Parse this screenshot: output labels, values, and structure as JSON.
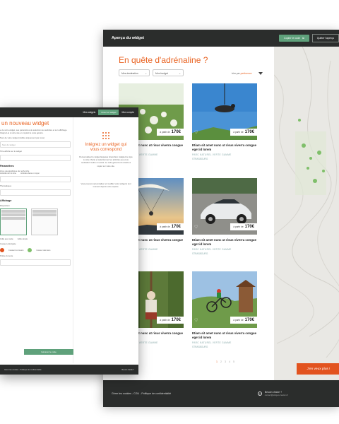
{
  "preview": {
    "title": "Aperçu du widget",
    "copy_label": "Copier le code",
    "quit_label": "Quitter l'aperçu",
    "headline": "En quête d'adrénaline ?",
    "filter_destination": "Mes destination",
    "filter_budget": "Mon budget",
    "sort_prefix": "trier par",
    "sort_value": "pertinence",
    "cards": [
      {
        "title": "Etiam sit amet nunc ut risus viverra congue eget id lorem",
        "meta": "PARC NATUREL VERTE GAMME",
        "meta2": "STRASBOURG",
        "price_prefix": "à partir de",
        "price": "170€"
      },
      {
        "title": "Etiam sit amet nunc ut risus viverra congue eget id lorem",
        "meta": "PARC NATUREL VERTE GAMME",
        "meta2": "STRASBOURG",
        "price_prefix": "à partir de",
        "price": "170€"
      },
      {
        "title": "Etiam sit amet nunc ut risus viverra congue eget id lorem",
        "meta": "PARC NATUREL VERTE GAMME",
        "meta2": "STRASBOURG",
        "price_prefix": "à partir de",
        "price": "170€"
      },
      {
        "title": "Etiam sit amet nunc ut risus viverra congue eget id lorem",
        "meta": "PARC NATUREL VERTE GAMME",
        "meta2": "STRASBOURG",
        "price_prefix": "à partir de",
        "price": "170€"
      },
      {
        "title": "Etiam sit amet nunc ut risus viverra congue eget id lorem",
        "meta": "PARC NATUREL VERTE GAMME",
        "meta2": "STRASBOURG",
        "price_prefix": "à partir de",
        "price": "170€"
      },
      {
        "title": "Etiam sit amet nunc ut risus viverra congue eget id lorem",
        "meta": "PARC NATUREL VERTE GAMME",
        "meta2": "STRASBOURG",
        "price_prefix": "à partir de",
        "price": "170€"
      }
    ],
    "pages": [
      "1",
      "2",
      "3",
      "4",
      "5"
    ],
    "cta": "J'en veux plus !",
    "footer_links": "Gérer les cookies - CGU - Politique de confidentialité",
    "help_title": "Besoin d'aide ?",
    "help_email": "contact@widget-creation.fr"
  },
  "form": {
    "nav_widgets": "Mes widgets",
    "nav_new": "Créer un widget",
    "nav_account": "Mon compte",
    "title": "un nouveau widget",
    "intro": "e de votre widget, ses paramètres de sélection des activités et son affichage. Intégrez-le à votre site en copiant le code généré.",
    "label_name": "Nom de votre widget (visible uniquement par vous)",
    "placeholder_name": "Nom du widget",
    "label_headline": "Titre affiché sur le widget",
    "section_params": "Paramètres",
    "label_zone": "Zone géographique de recherche",
    "opt_a": "Activités sur la zone",
    "opt_b": "Activités dans un rayon",
    "label_theme": "Thématiques",
    "section_display": "Affichage",
    "label_layout": "Disposition",
    "layout_a": "Grille avec carte",
    "layout_b": "Grille simple",
    "label_color": "Couleur principale",
    "color_a": "Couleur du bouton",
    "color_b": "Couleur des liens",
    "label_font": "Police du texte",
    "submit": "Générer le code",
    "side_title": "Intégrez un widget qui vous correspond",
    "side_text": "Personnalisez le widget Espaces Grand Est. Adaptez le style à votre charte et sélectionnez les activités que vous souhaitez mettre en avant. Le code généré est ensuite à copier sur votre site.",
    "side_text2": "Vous pouvez personnaliser et modifier votre widget à tout moment depuis votre espace.",
    "footer_left": "Gérer les cookies - Politique de confidentialité",
    "footer_help": "Besoin d'aide ?"
  }
}
